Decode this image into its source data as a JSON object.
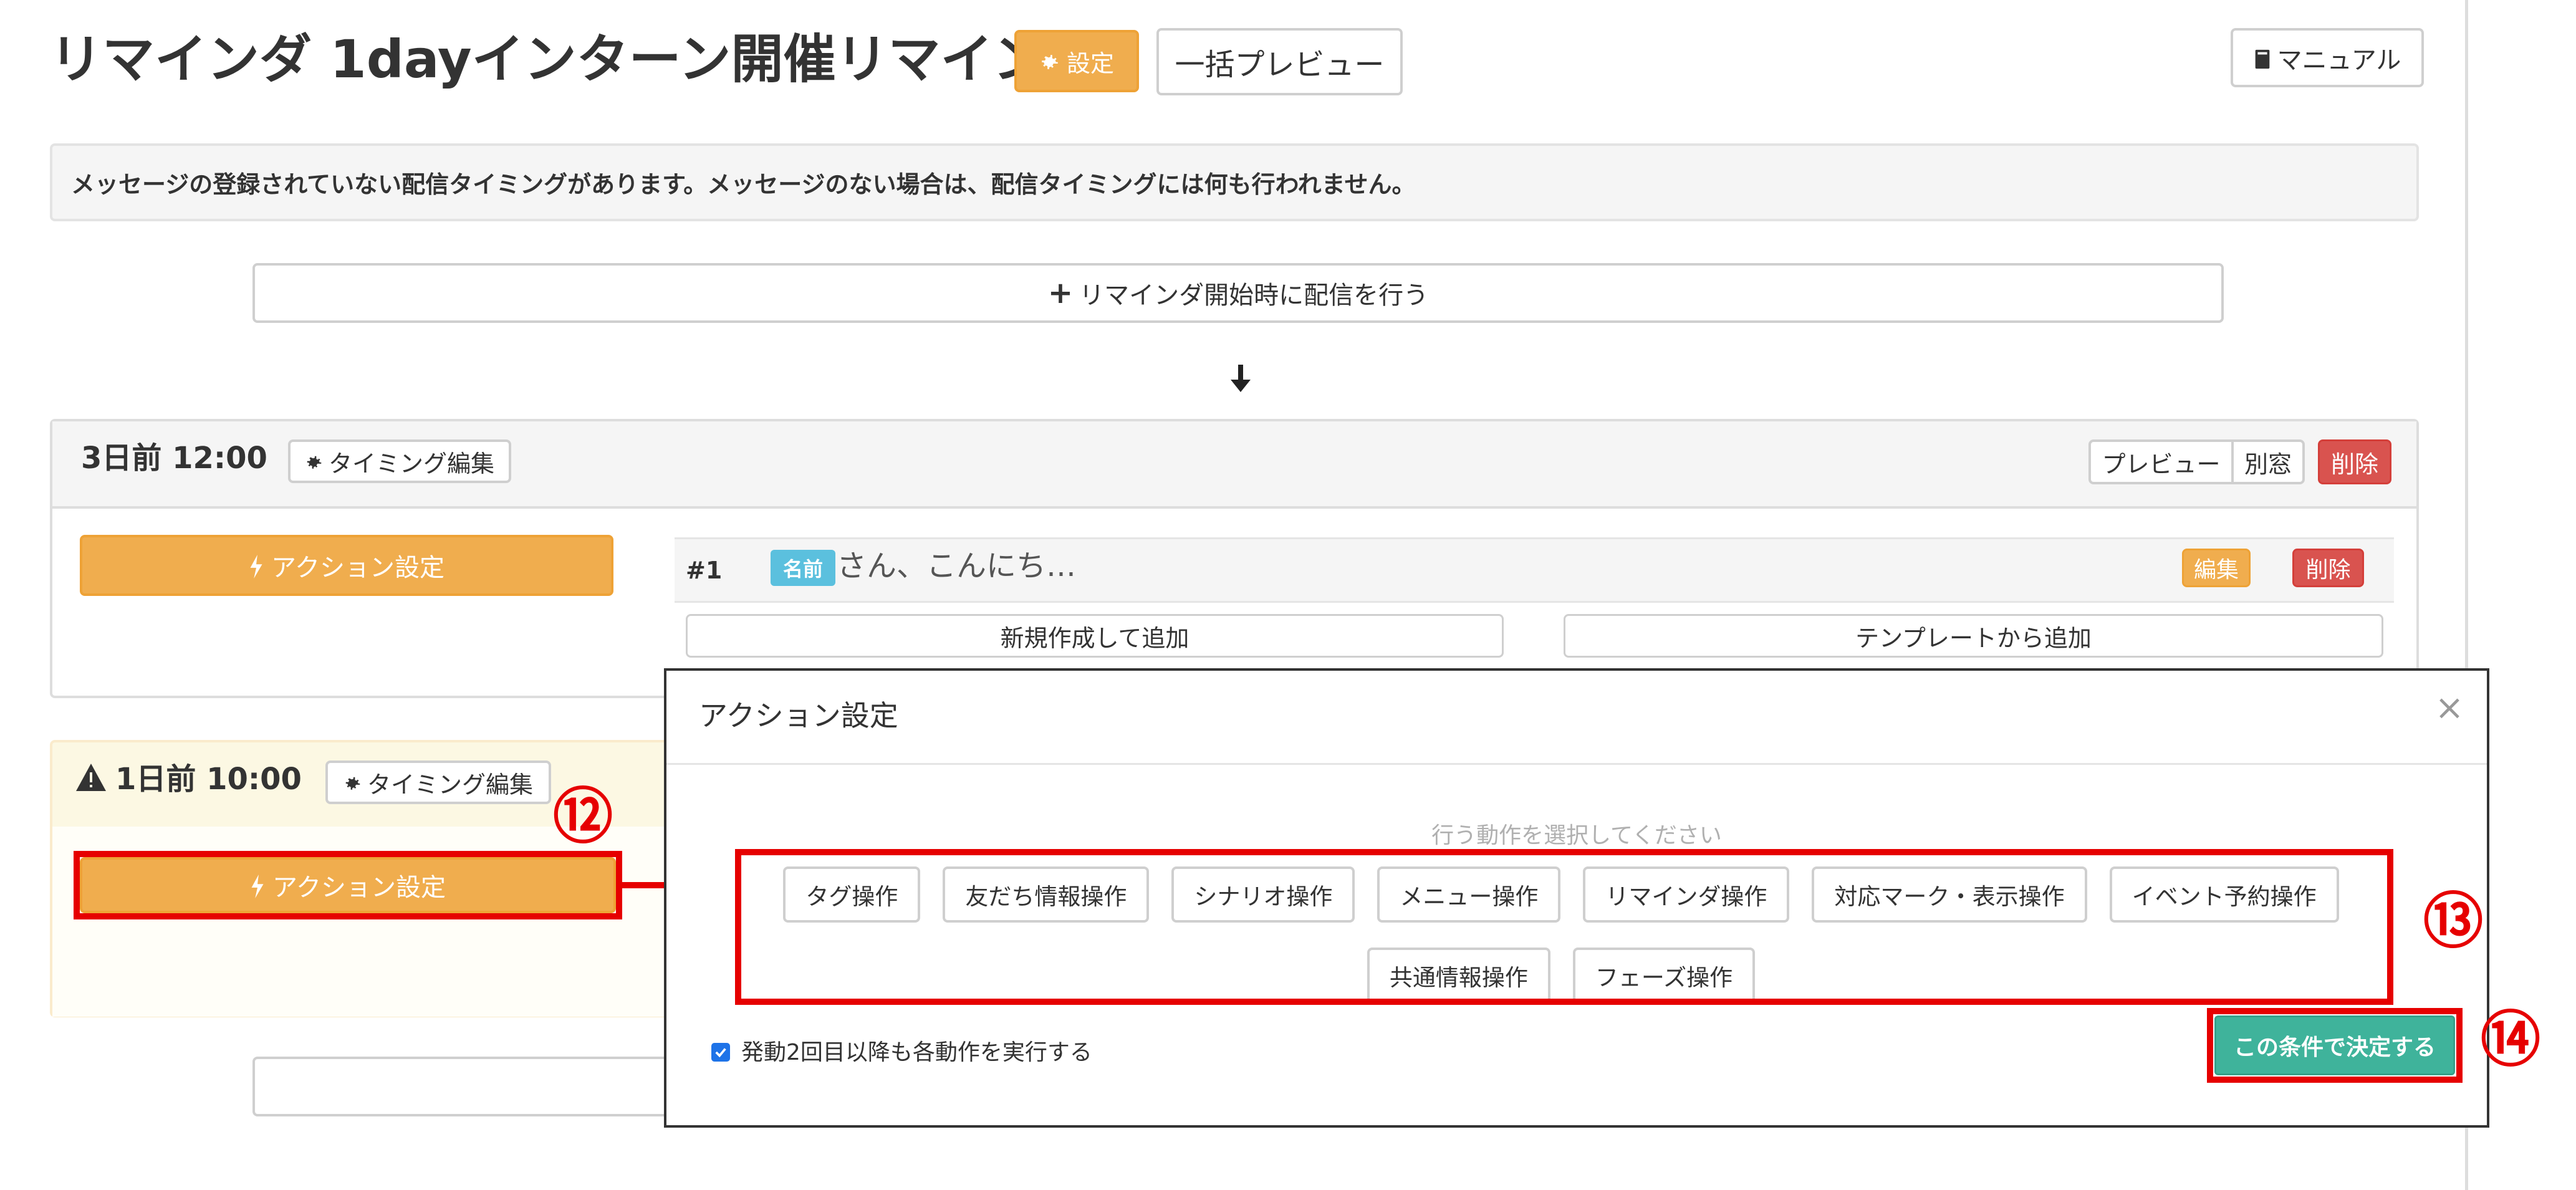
{
  "header": {
    "title": "リマインダ 1dayインターン開催リマインド",
    "settings_label": "設定",
    "bulk_preview_label": "一括プレビュー",
    "manual_label": "マニュアル"
  },
  "alert": {
    "text": "メッセージの登録されていない配信タイミングがあります。メッセージのない場合は、配信タイミングには何も行われません。"
  },
  "start_delivery_label": "リマインダ開始時に配信を行う",
  "timings": [
    {
      "time": "3日前 12:00",
      "edit_timing_label": "タイミング編集",
      "preview_label": "プレビュー",
      "separate_window_label": "別窓",
      "delete_label": "削除",
      "action_label": "アクション設定",
      "message": {
        "number": "#1",
        "badge": "名前",
        "text": "さん、こんにち…",
        "edit_label": "編集",
        "delete_label": "削除"
      },
      "add_new_label": "新規作成して追加",
      "add_template_label": "テンプレートから追加"
    },
    {
      "time": "1日前 10:00",
      "edit_timing_label": "タイミング編集",
      "action_label": "アクション設定"
    }
  ],
  "modal": {
    "title": "アクション設定",
    "close_symbol": "×",
    "hint": "行う動作を選択してください",
    "operations": [
      "タグ操作",
      "友だち情報操作",
      "シナリオ操作",
      "メニュー操作",
      "リマインダ操作",
      "対応マーク・表示操作",
      "イベント予約操作",
      "共通情報操作",
      "フェーズ操作"
    ],
    "checkbox_label": "発動2回目以降も各動作を実行する",
    "checkbox_checked": true,
    "confirm_label": "この条件で決定する"
  },
  "annotations": {
    "step12": "⑫",
    "step13": "⑬",
    "step14": "⑭"
  },
  "colors": {
    "orange": "#f0ad4e",
    "red": "#d9534f",
    "teal": "#3fb39b",
    "info": "#5bc0de",
    "annotation_red": "#e60000"
  }
}
